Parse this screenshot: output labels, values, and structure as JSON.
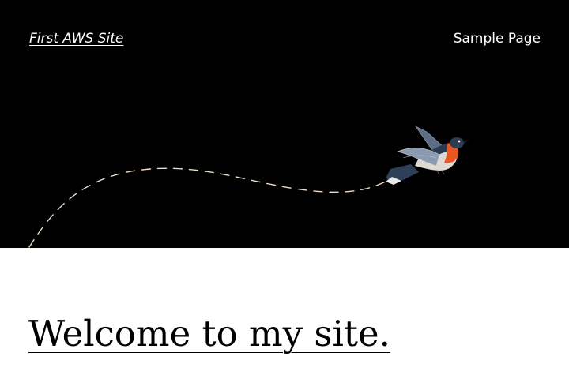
{
  "header": {
    "site_title": "First AWS Site",
    "nav_link": "Sample Page"
  },
  "hero": {
    "illustration": "hummingbird-icon",
    "trail": "dashed-flight-path",
    "colors": {
      "background": "#000000",
      "trail": "#f1dcc6",
      "bird_throat": "#e8571f"
    }
  },
  "main": {
    "heading": "Welcome to my site."
  }
}
